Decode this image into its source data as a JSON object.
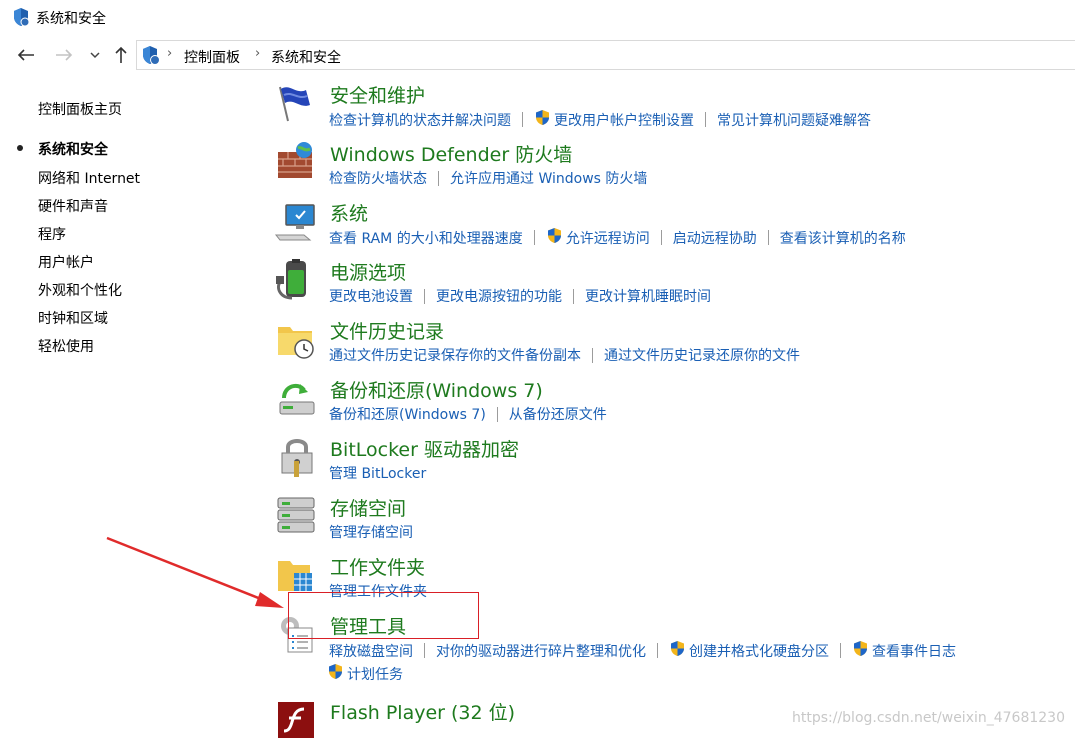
{
  "window": {
    "title": "系统和安全"
  },
  "nav": {
    "back_icon": "back-arrow-icon",
    "forward_icon": "forward-arrow-icon",
    "recent_icon": "chevron-down-icon",
    "up_icon": "up-arrow-icon"
  },
  "address": {
    "crumbs": [
      "控制面板",
      "系统和安全"
    ]
  },
  "sidebar": {
    "items": [
      {
        "label": "控制面板主页",
        "active": false
      },
      {
        "label": "系统和安全",
        "active": true
      },
      {
        "label": "网络和 Internet",
        "active": false
      },
      {
        "label": "硬件和声音",
        "active": false
      },
      {
        "label": "程序",
        "active": false
      },
      {
        "label": "用户帐户",
        "active": false
      },
      {
        "label": "外观和个性化",
        "active": false
      },
      {
        "label": "时钟和区域",
        "active": false
      },
      {
        "label": "轻松使用",
        "active": false
      }
    ]
  },
  "categories": [
    {
      "title": "安全和维护",
      "icon": "security-flag-icon",
      "links": [
        {
          "label": "检查计算机的状态并解决问题",
          "shield": false
        },
        {
          "label": "更改用户帐户控制设置",
          "shield": true
        },
        {
          "label": "常见计算机问题疑难解答",
          "shield": false
        }
      ]
    },
    {
      "title": "Windows Defender 防火墙",
      "icon": "firewall-icon",
      "links": [
        {
          "label": "检查防火墙状态",
          "shield": false
        },
        {
          "label": "允许应用通过 Windows 防火墙",
          "shield": false
        }
      ]
    },
    {
      "title": "系统",
      "icon": "computer-icon",
      "links": [
        {
          "label": "查看 RAM 的大小和处理器速度",
          "shield": false
        },
        {
          "label": "允许远程访问",
          "shield": true
        },
        {
          "label": "启动远程协助",
          "shield": false
        },
        {
          "label": "查看该计算机的名称",
          "shield": false
        }
      ]
    },
    {
      "title": "电源选项",
      "icon": "battery-icon",
      "links": [
        {
          "label": "更改电池设置",
          "shield": false
        },
        {
          "label": "更改电源按钮的功能",
          "shield": false
        },
        {
          "label": "更改计算机睡眠时间",
          "shield": false
        }
      ]
    },
    {
      "title": "文件历史记录",
      "icon": "file-history-icon",
      "links": [
        {
          "label": "通过文件历史记录保存你的文件备份副本",
          "shield": false
        },
        {
          "label": "通过文件历史记录还原你的文件",
          "shield": false
        }
      ]
    },
    {
      "title": "备份和还原(Windows 7)",
      "icon": "backup-restore-icon",
      "links": [
        {
          "label": "备份和还原(Windows 7)",
          "shield": false
        },
        {
          "label": "从备份还原文件",
          "shield": false
        }
      ]
    },
    {
      "title": "BitLocker 驱动器加密",
      "icon": "bitlocker-icon",
      "links": [
        {
          "label": "管理 BitLocker",
          "shield": false
        }
      ]
    },
    {
      "title": "存储空间",
      "icon": "storage-spaces-icon",
      "links": [
        {
          "label": "管理存储空间",
          "shield": false
        }
      ]
    },
    {
      "title": "工作文件夹",
      "icon": "work-folders-icon",
      "links": [
        {
          "label": "管理工作文件夹",
          "shield": false
        }
      ]
    },
    {
      "title": "管理工具",
      "icon": "admin-tools-icon",
      "links": [
        {
          "label": "释放磁盘空间",
          "shield": false
        },
        {
          "label": "对你的驱动器进行碎片整理和优化",
          "shield": false
        },
        {
          "label": "创建并格式化硬盘分区",
          "shield": true
        },
        {
          "label": "查看事件日志",
          "shield": true
        }
      ],
      "links2": [
        {
          "label": "计划任务",
          "shield": true
        }
      ]
    },
    {
      "title": "Flash Player (32 位)",
      "icon": "flash-player-icon",
      "links": []
    }
  ],
  "annotation": {
    "arrow_icon": "red-arrow-icon",
    "highlight_color": "#d91f26"
  },
  "watermark": "https://blog.csdn.net/weixin_47681230",
  "colors": {
    "title_green": "#1e7a1e",
    "link_blue": "#1a5fb4"
  }
}
